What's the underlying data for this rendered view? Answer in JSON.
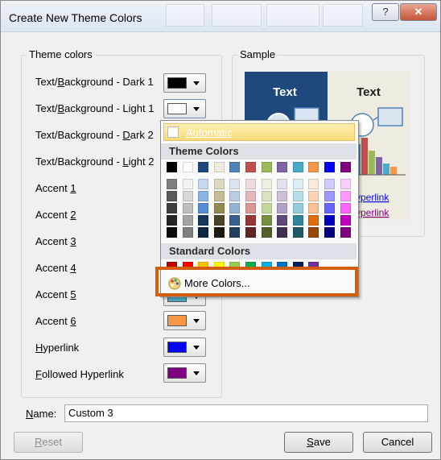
{
  "window": {
    "title": "Create New Theme Colors",
    "help_glyph": "?",
    "close_glyph": "✕"
  },
  "theme_colors_group": {
    "legend": "Theme colors",
    "rows": [
      {
        "pre": "Text/",
        "key": "B",
        "post": "ackground - Dark 1",
        "swatch": "#000000"
      },
      {
        "pre": "Text/",
        "key": "B",
        "post": "ackground - Light 1",
        "swatch": "#ffffff"
      },
      {
        "pre": "Text/Background - ",
        "key": "D",
        "post": "ark 2",
        "swatch": ""
      },
      {
        "pre": "Text/Background - ",
        "key": "L",
        "post": "ight 2",
        "swatch": ""
      },
      {
        "pre": "Accent ",
        "key": "1",
        "post": "",
        "swatch": ""
      },
      {
        "pre": "Accent ",
        "key": "2",
        "post": "",
        "swatch": ""
      },
      {
        "pre": "Accent ",
        "key": "3",
        "post": "",
        "swatch": ""
      },
      {
        "pre": "Accent ",
        "key": "4",
        "post": "",
        "swatch": ""
      },
      {
        "pre": "Accent ",
        "key": "5",
        "post": "",
        "swatch": "#4bacc6"
      },
      {
        "pre": "Accent ",
        "key": "6",
        "post": "",
        "swatch": "#f79646"
      },
      {
        "pre": "",
        "key": "H",
        "post": "yperlink",
        "swatch": "#0000ff"
      },
      {
        "pre": "",
        "key": "F",
        "post": "ollowed Hyperlink",
        "swatch": "#800080"
      }
    ]
  },
  "sample_group": {
    "legend": "Sample",
    "dark_text": "Text",
    "light_text": "Text",
    "hyperlink": "yperlink",
    "followed": "yperlink"
  },
  "color_menu": {
    "automatic": "Automatic",
    "theme_header": "Theme Colors",
    "standard_header": "Standard Colors",
    "more_colors": "More Colors...",
    "theme_top_row": [
      "#000000",
      "#ffffff",
      "#1f497d",
      "#eeece1",
      "#4f81bd",
      "#c0504d",
      "#9bbb59",
      "#8064a2",
      "#4bacc6",
      "#f79646",
      "#0000ff",
      "#800080"
    ],
    "theme_shades": [
      [
        "#7f7f7f",
        "#595959",
        "#3f3f3f",
        "#262626",
        "#0c0c0c"
      ],
      [
        "#f2f2f2",
        "#d8d8d8",
        "#bfbfbf",
        "#a5a5a5",
        "#7f7f7f"
      ],
      [
        "#c6d9f0",
        "#8db3e2",
        "#548dd4",
        "#17365d",
        "#0f243e"
      ],
      [
        "#ddd9c3",
        "#c4bd97",
        "#938953",
        "#494429",
        "#1d1b10"
      ],
      [
        "#dbe5f1",
        "#b8cce4",
        "#95b3d7",
        "#366092",
        "#244061"
      ],
      [
        "#f2dcdb",
        "#e5b9b7",
        "#d99694",
        "#953734",
        "#632423"
      ],
      [
        "#ebf1dd",
        "#d7e3bc",
        "#c3d69b",
        "#76923c",
        "#4f6128"
      ],
      [
        "#e5e0ec",
        "#ccc1d9",
        "#b2a2c7",
        "#5f497a",
        "#3f3151"
      ],
      [
        "#dbeef3",
        "#b7dde8",
        "#92cddc",
        "#31859b",
        "#205867"
      ],
      [
        "#fdeada",
        "#fbd5b5",
        "#fac08f",
        "#e36c09",
        "#974806"
      ],
      [
        "#ccccff",
        "#9999ff",
        "#6666ff",
        "#0000bf",
        "#00007f"
      ],
      [
        "#ffccff",
        "#ff99ff",
        "#ff66ff",
        "#bf00bf",
        "#7f007f"
      ]
    ],
    "standard_row": [
      "#c00000",
      "#ff0000",
      "#ffc000",
      "#ffff00",
      "#92d050",
      "#00b050",
      "#00b0f0",
      "#0070c0",
      "#002060",
      "#7030a0"
    ]
  },
  "name_field": {
    "label_key": "N",
    "label_post": "ame:",
    "value": "Custom 3"
  },
  "buttons": {
    "reset_key": "R",
    "reset_post": "eset",
    "save_key": "S",
    "save_post": "ave",
    "cancel": "Cancel"
  },
  "sample_colors": {
    "dark_bg": "#1f497d",
    "light_bg": "#eeece1",
    "bars": [
      "#4f81bd",
      "#c0504d",
      "#9bbb59",
      "#8064a2",
      "#4bacc6",
      "#f79646"
    ]
  }
}
